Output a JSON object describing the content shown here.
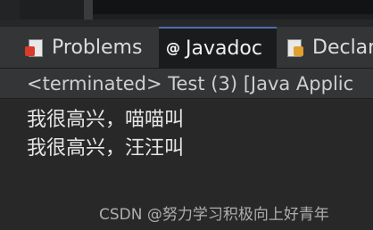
{
  "tabs": {
    "problems": {
      "label": "Problems",
      "icon": "problems-icon"
    },
    "javadoc": {
      "label": "Javadoc",
      "icon": "at-icon",
      "glyph": "@"
    },
    "declaration": {
      "label": "Declar",
      "icon": "declaration-icon"
    }
  },
  "console": {
    "header": "<terminated> Test (3) [Java Applic",
    "lines": [
      "我很高兴，喵喵叫",
      "我很高兴，汪汪叫"
    ]
  },
  "watermark": "CSDN @努力学习积极向上好青年",
  "colors": {
    "active_tab_accent": "#4b6eaf",
    "problems_error": "#d83a2e"
  }
}
